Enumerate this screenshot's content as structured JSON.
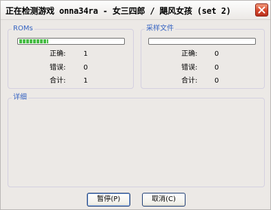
{
  "window": {
    "title": "正在检测游戏 onna34ra - 女三四郎 / 飓风女孩 (set 2)",
    "close_icon": "close-icon"
  },
  "roms": {
    "label": "ROMs",
    "progress": 0.28,
    "correct_label": "正确:",
    "correct_value": "1",
    "error_label": "错误:",
    "error_value": "0",
    "total_label": "合计:",
    "total_value": "1"
  },
  "samples": {
    "label": "采样文件",
    "progress": 0,
    "correct_label": "正确:",
    "correct_value": "0",
    "error_label": "错误:",
    "error_value": "0",
    "total_label": "合计:",
    "total_value": "0"
  },
  "details": {
    "label": "详细"
  },
  "buttons": {
    "pause": "暂停(P)",
    "cancel": "取消(C)"
  }
}
